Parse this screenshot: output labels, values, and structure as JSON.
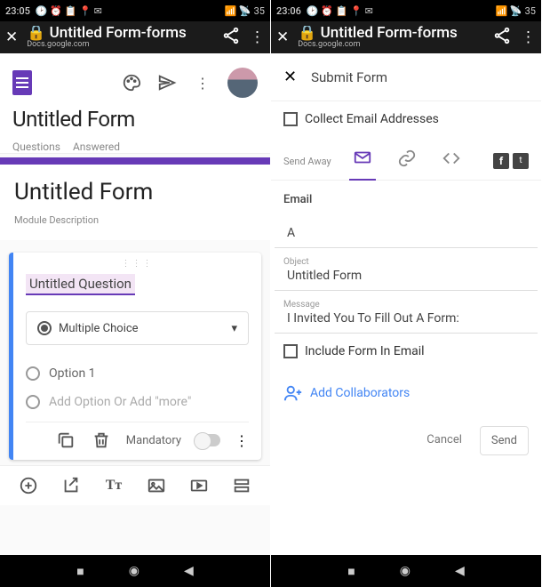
{
  "left": {
    "status": {
      "time": "23:05",
      "battery": "35"
    },
    "url": {
      "title": "Untitled Form-forms",
      "sub": "Docs.google.com"
    },
    "formTitle": "Untitled Form",
    "tab1": "Questions",
    "tab2": "Answered",
    "cardTitle": "Untitled Form",
    "cardDesc": "Module Description",
    "question": "Untitled Question",
    "selectLabel": "Multiple Choice",
    "option1": "Option 1",
    "addOption": "Add Option Or Add \"more\"",
    "mandatory": "Mandatory"
  },
  "right": {
    "status": {
      "time": "23:06",
      "battery": "35"
    },
    "url": {
      "title": "Untitled Form-forms",
      "sub": "Docs.google.com"
    },
    "modalTitle": "Submit Form",
    "collect": "Collect Email Addresses",
    "sendAway": "Send Away",
    "emailHeader": "Email",
    "a": "A",
    "objectLbl": "Object",
    "objectVal": "Untitled Form",
    "msgLbl": "Message",
    "msgVal": "I Invited You To Fill Out A Form:",
    "include": "Include Form In Email",
    "addCollab": "Add Collaborators",
    "cancel": "Cancel",
    "send": "Send"
  }
}
